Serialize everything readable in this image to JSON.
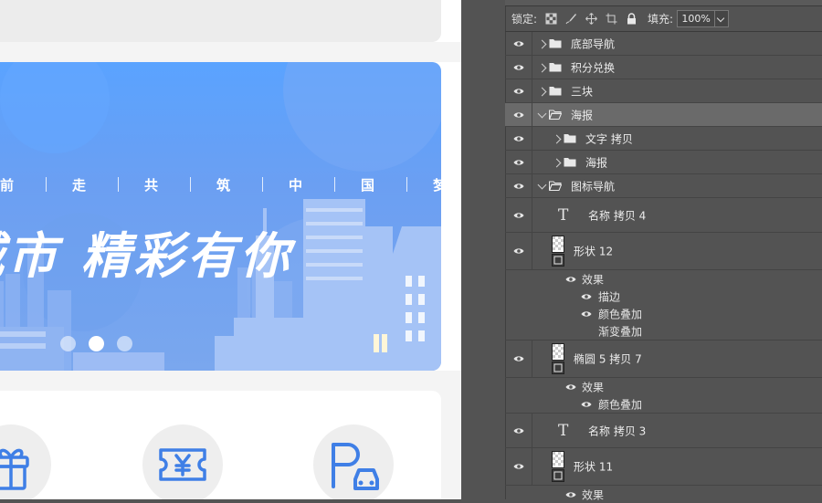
{
  "banner": {
    "slogan_chars": [
      "前",
      "走",
      "共",
      "筑",
      "中",
      "国",
      "梦"
    ],
    "headline": "城市  精彩有你",
    "carousel_dots": 3,
    "active_dot": 1
  },
  "icon_nav": [
    "gift-icon",
    "coupon-yen-icon",
    "parking-car-icon"
  ],
  "lock_bar": {
    "lock_label": "锁定:",
    "lock_icons": [
      "lock-transparent-pixels-icon",
      "lock-image-pixels-icon",
      "lock-position-icon",
      "lock-artboard-icon",
      "lock-all-icon"
    ],
    "fill_label": "填充:",
    "fill_value": "100%"
  },
  "layers": [
    {
      "id": "l1",
      "label": "底部导航",
      "type": "group",
      "expanded": false,
      "depth": 0,
      "selected": false
    },
    {
      "id": "l2",
      "label": "积分兑换",
      "type": "group",
      "expanded": false,
      "depth": 0,
      "selected": false
    },
    {
      "id": "l3",
      "label": "三块",
      "type": "group",
      "expanded": false,
      "depth": 0,
      "selected": false
    },
    {
      "id": "l4",
      "label": "海报",
      "type": "group",
      "expanded": true,
      "depth": 0,
      "selected": true
    },
    {
      "id": "l5",
      "label": "文字 拷贝",
      "type": "group",
      "expanded": false,
      "depth": 1,
      "selected": false
    },
    {
      "id": "l6",
      "label": "海报",
      "type": "group",
      "expanded": false,
      "depth": 1,
      "selected": false
    },
    {
      "id": "l7",
      "label": "图标导航",
      "type": "group",
      "expanded": true,
      "depth": 0,
      "selected": false
    },
    {
      "id": "l8",
      "label": "名称 拷贝 4",
      "type": "text",
      "depth": 1
    },
    {
      "id": "l9",
      "label": "形状 12",
      "type": "shape",
      "depth": 1,
      "effects_label": "效果",
      "effects": [
        {
          "label": "描边",
          "visible": true
        },
        {
          "label": "颜色叠加",
          "visible": true
        },
        {
          "label": "渐变叠加",
          "visible": false
        }
      ]
    },
    {
      "id": "l10",
      "label": "椭圆 5 拷贝 7",
      "type": "shape",
      "depth": 1,
      "effects_label": "效果",
      "effects": [
        {
          "label": "颜色叠加",
          "visible": true
        }
      ]
    },
    {
      "id": "l11",
      "label": "名称 拷贝 3",
      "type": "text",
      "depth": 1
    },
    {
      "id": "l12",
      "label": "形状 11",
      "type": "shape",
      "depth": 1,
      "effects_label": "效果",
      "effects": []
    }
  ],
  "colors": {
    "panel_bg": "#535353",
    "selected_row": "#6a6a6a",
    "banner_blue": "#5aa3ff",
    "icon_blue": "#3f7fe6"
  }
}
